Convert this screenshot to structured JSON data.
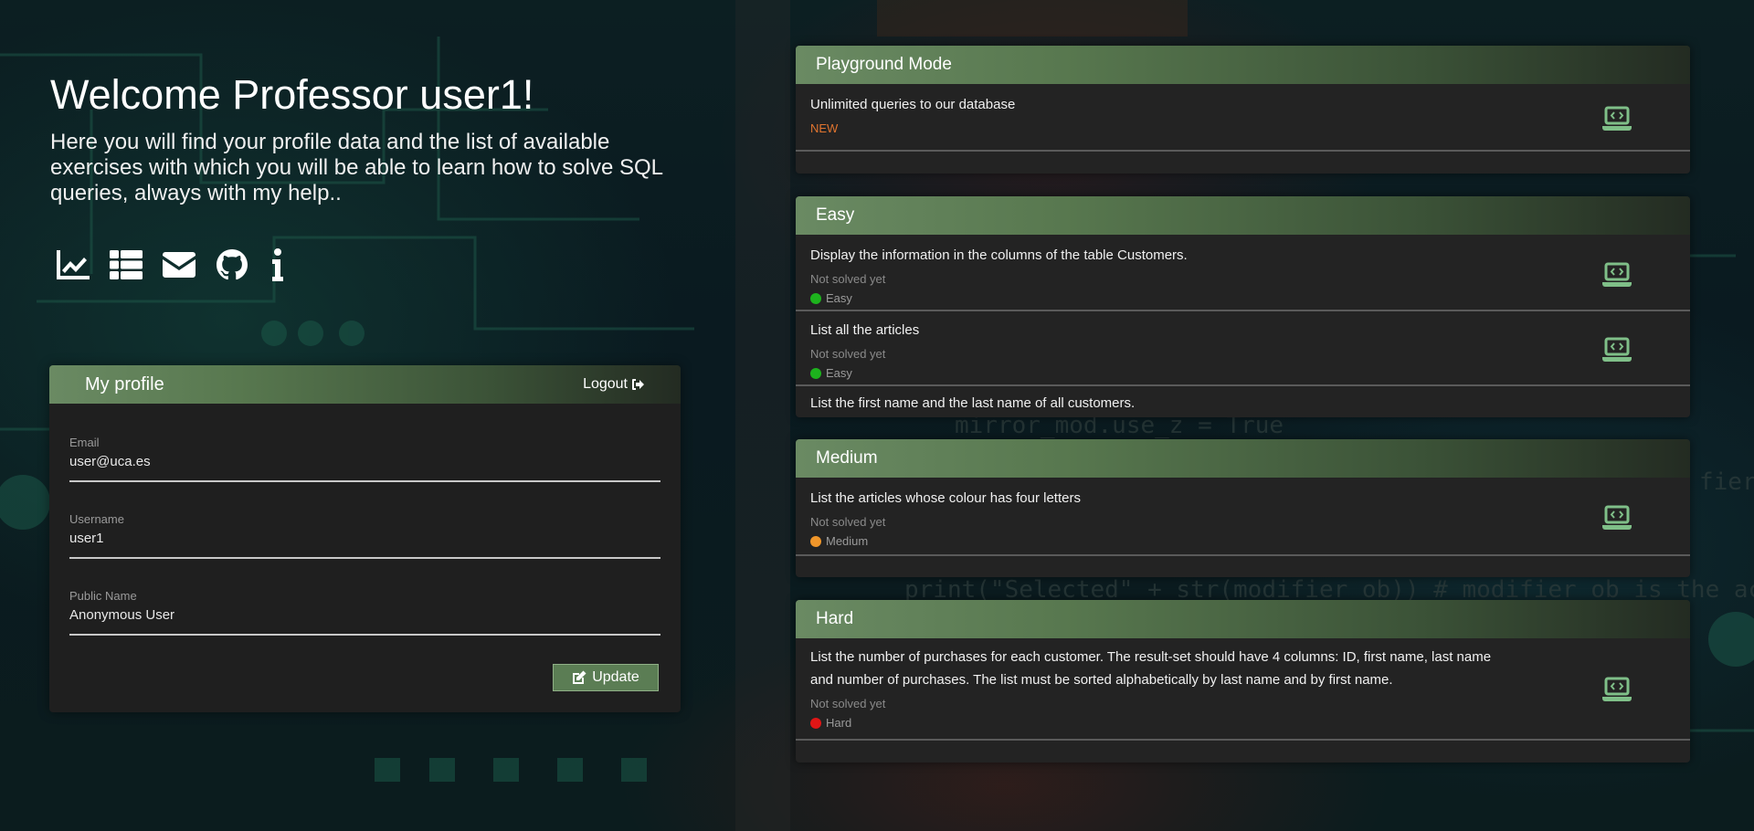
{
  "welcome": {
    "title": "Welcome Professor user1!",
    "subtitle": "Here you will find your profile data and the list of available exercises with which you will be able to learn how to solve SQL queries, always with my help.."
  },
  "nav_icons": [
    "chart-line-icon",
    "table-list-icon",
    "envelope-icon",
    "github-icon",
    "info-icon"
  ],
  "profile": {
    "title": "My profile",
    "logout_label": "Logout",
    "fields": [
      {
        "label": "Email",
        "value": "user@uca.es"
      },
      {
        "label": "Username",
        "value": "user1"
      },
      {
        "label": "Public Name",
        "value": "Anonymous User"
      }
    ],
    "update_label": "Update"
  },
  "sections": {
    "playground": {
      "title": "Playground Mode",
      "items": [
        {
          "question": "Unlimited queries to our database",
          "badge": "NEW"
        }
      ]
    },
    "easy": {
      "title": "Easy",
      "items": [
        {
          "question": "Display the information in the columns of the table Customers.",
          "status": "Not solved yet",
          "difficulty": "Easy"
        },
        {
          "question": "List all the articles",
          "status": "Not solved yet",
          "difficulty": "Easy"
        },
        {
          "question": "List the first name and the last name of all customers."
        }
      ]
    },
    "medium": {
      "title": "Medium",
      "items": [
        {
          "question": "List the articles whose colour has four letters",
          "status": "Not solved yet",
          "difficulty": "Medium"
        }
      ]
    },
    "hard": {
      "title": "Hard",
      "items": [
        {
          "question": "List the number of purchases for each customer. The result-set should have 4 columns: ID, first name, last name and number of purchases. The list must be sorted alphabetically by last name and by first name.",
          "status": "Not solved yet",
          "difficulty": "Hard"
        }
      ]
    }
  },
  "colors": {
    "header_green": "#6a8a63",
    "easy": "#1db31d",
    "medium": "#f0962a",
    "hard": "#e01616",
    "new_badge": "#e0742f",
    "laptop_icon": "#7fbf88"
  }
}
